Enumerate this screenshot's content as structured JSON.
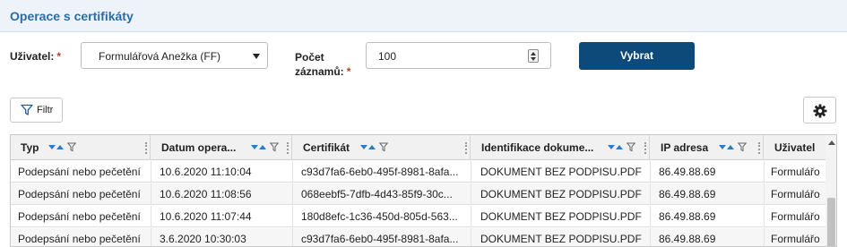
{
  "panel": {
    "title": "Operace s certifikáty"
  },
  "form": {
    "user_label": "Uživatel:",
    "user_required": "*",
    "user_value": "Formulářová Anežka (FF)",
    "count_label_1": "Počet",
    "count_label_2": "záznamů:",
    "count_required": "*",
    "count_value": "100",
    "submit_label": "Vybrat"
  },
  "toolbar": {
    "filter_label": "Filtr",
    "filter_icon": "filter-icon",
    "settings_icon": "gear-icon"
  },
  "grid": {
    "columns": [
      {
        "label": "Typ"
      },
      {
        "label": "Datum opera..."
      },
      {
        "label": "Certifikát"
      },
      {
        "label": "Identifikace dokume..."
      },
      {
        "label": "IP adresa"
      },
      {
        "label": "Uživatel"
      }
    ],
    "rows": [
      [
        "Podepsání nebo pečetění",
        "10.6.2020 11:10:04",
        "c93d7fa6-6eb0-495f-8981-8afa...",
        "DOKUMENT BEZ PODPISU.PDF",
        "86.49.88.69",
        "Formulářo"
      ],
      [
        "Podepsání nebo pečetění",
        "10.6.2020 11:08:56",
        "068eebf5-7dfb-4d43-85f9-30c...",
        "DOKUMENT BEZ PODPISU.PDF",
        "86.49.88.69",
        "Formulářo"
      ],
      [
        "Podepsání nebo pečetění",
        "10.6.2020 11:07:44",
        "180d8efc-1c36-450d-805d-563...",
        "DOKUMENT BEZ PODPISU.PDF",
        "86.49.88.69",
        "Formulářo"
      ],
      [
        "Podepsání nebo pečetění",
        "3.6.2020 10:30:03",
        "c93d7fa6-6eb0-495f-8981-8afa...",
        "DOKUMENT BEZ PODPISU.PDF",
        "86.49.88.69",
        "Formulářo"
      ]
    ]
  },
  "colors": {
    "accent": "#2a6ca8",
    "primary_button": "#0d4a7a",
    "required": "#c0392b",
    "sort_arrow": "#2a7cc7"
  }
}
